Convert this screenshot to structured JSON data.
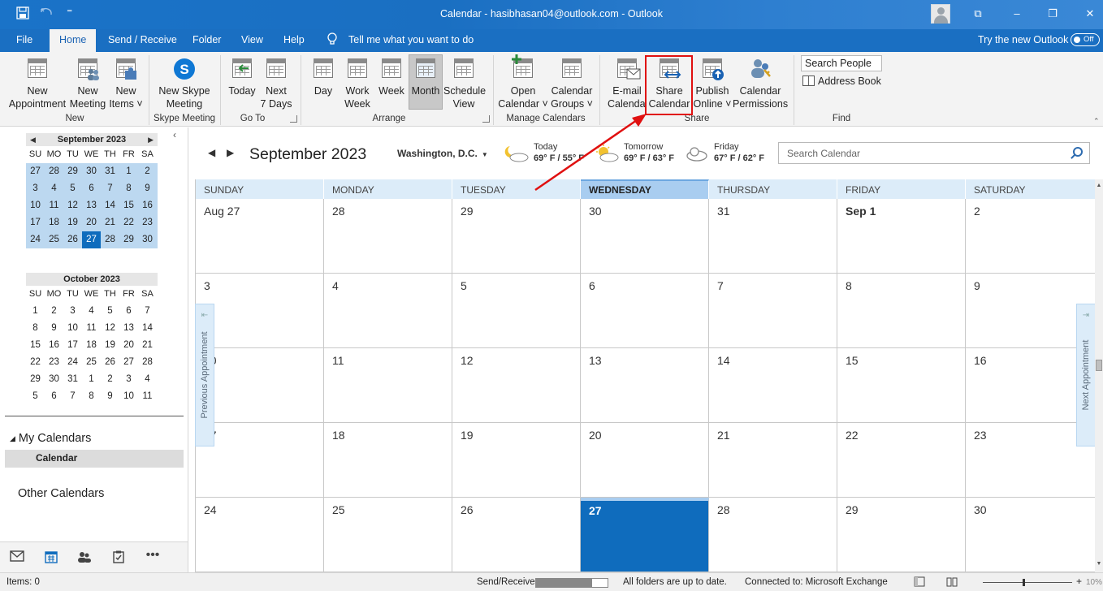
{
  "window": {
    "title": "Calendar - hasibhasan04@outlook.com  -  Outlook",
    "controls": {
      "minimize": "–",
      "restore": "❐",
      "close": "✕",
      "ribbon_display": "⧉"
    }
  },
  "qat": {
    "save_icon": "save-icon",
    "undo_icon": "undo-icon",
    "customize": "⁼"
  },
  "menu": {
    "tabs": [
      "File",
      "Home",
      "Send / Receive",
      "Folder",
      "View",
      "Help"
    ],
    "active_tab": "Home",
    "tell_me": "Tell me what you want to do",
    "try_new": "Try the new Outlook",
    "toggle_label": "Off"
  },
  "ribbon": {
    "new_group": {
      "name": "New",
      "new_appointment": [
        "New",
        "Appointment"
      ],
      "new_meeting": [
        "New",
        "Meeting"
      ],
      "new_items": [
        "New",
        "Items ˅"
      ]
    },
    "skype_group": {
      "name": "Skype Meeting",
      "new_skype": [
        "New Skype",
        "Meeting"
      ]
    },
    "goto_group": {
      "name": "Go To",
      "today": [
        "Today",
        ""
      ],
      "next7": [
        "Next",
        "7 Days"
      ]
    },
    "arrange_group": {
      "name": "Arrange",
      "day": "Day",
      "work_week": [
        "Work",
        "Week"
      ],
      "week": "Week",
      "month": "Month",
      "schedule": [
        "Schedule",
        "View"
      ]
    },
    "manage_group": {
      "name": "Manage Calendars",
      "open_calendar": [
        "Open",
        "Calendar ˅"
      ],
      "calendar_groups": [
        "Calendar",
        "Groups ˅"
      ]
    },
    "share_group": {
      "name": "Share",
      "email_calendar": [
        "E-mail",
        "Calendar"
      ],
      "share_calendar": [
        "Share",
        "Calendar"
      ],
      "publish_online": [
        "Publish",
        "Online ˅"
      ],
      "calendar_permissions": [
        "Calendar",
        "Permissions"
      ]
    },
    "find_group": {
      "name": "Find",
      "search_people": "Search People",
      "address_book": "Address Book"
    }
  },
  "mini_calendars": {
    "dow": [
      "SU",
      "MO",
      "TU",
      "WE",
      "TH",
      "FR",
      "SA"
    ],
    "september": {
      "title": "September 2023",
      "weeks": [
        [
          "27",
          "28",
          "29",
          "30",
          "31",
          "1",
          "2"
        ],
        [
          "3",
          "4",
          "5",
          "6",
          "7",
          "8",
          "9"
        ],
        [
          "10",
          "11",
          "12",
          "13",
          "14",
          "15",
          "16"
        ],
        [
          "17",
          "18",
          "19",
          "20",
          "21",
          "22",
          "23"
        ],
        [
          "24",
          "25",
          "26",
          "27",
          "28",
          "29",
          "30"
        ]
      ],
      "today": "27"
    },
    "october": {
      "title": "October 2023",
      "weeks": [
        [
          "1",
          "2",
          "3",
          "4",
          "5",
          "6",
          "7"
        ],
        [
          "8",
          "9",
          "10",
          "11",
          "12",
          "13",
          "14"
        ],
        [
          "15",
          "16",
          "17",
          "18",
          "19",
          "20",
          "21"
        ],
        [
          "22",
          "23",
          "24",
          "25",
          "26",
          "27",
          "28"
        ],
        [
          "29",
          "30",
          "31",
          "1",
          "2",
          "3",
          "4"
        ],
        [
          "5",
          "6",
          "7",
          "8",
          "9",
          "10",
          "11"
        ]
      ]
    }
  },
  "folders": {
    "my_calendars": "My Calendars",
    "calendar": "Calendar",
    "other_calendars": "Other Calendars"
  },
  "calendar": {
    "month_title": "September 2023",
    "location": "Washington,  D.C.",
    "weather": [
      {
        "day": "Today",
        "temp": "69° F / 55° F",
        "icon": "moon-cloud-icon"
      },
      {
        "day": "Tomorrow",
        "temp": "69° F / 63° F",
        "icon": "partly-sunny-icon"
      },
      {
        "day": "Friday",
        "temp": "67° F / 62° F",
        "icon": "cloud-icon"
      }
    ],
    "search_placeholder": "Search Calendar",
    "day_headers": [
      "SUNDAY",
      "MONDAY",
      "TUESDAY",
      "WEDNESDAY",
      "THURSDAY",
      "FRIDAY",
      "SATURDAY"
    ],
    "today_header_index": 3,
    "weeks": [
      [
        "Aug 27",
        "28",
        "29",
        "30",
        "31",
        "Sep 1",
        "2"
      ],
      [
        "3",
        "4",
        "5",
        "6",
        "7",
        "8",
        "9"
      ],
      [
        "10",
        "11",
        "12",
        "13",
        "14",
        "15",
        "16"
      ],
      [
        "17",
        "18",
        "19",
        "20",
        "21",
        "22",
        "23"
      ],
      [
        "24",
        "25",
        "26",
        "27",
        "28",
        "29",
        "30"
      ]
    ],
    "previous_appointment": "Previous Appointment",
    "next_appointment": "Next Appointment"
  },
  "status": {
    "items": "Items: 0",
    "send_receive": "Send/Receive",
    "progress": 0.78,
    "folders_status": "All folders are up to date.",
    "connection": "Connected to: Microsoft Exchange",
    "zoom": "10%",
    "zoom_level": 0.45
  },
  "colors": {
    "accent": "#0f6cbd",
    "highlight": "#e01010"
  }
}
